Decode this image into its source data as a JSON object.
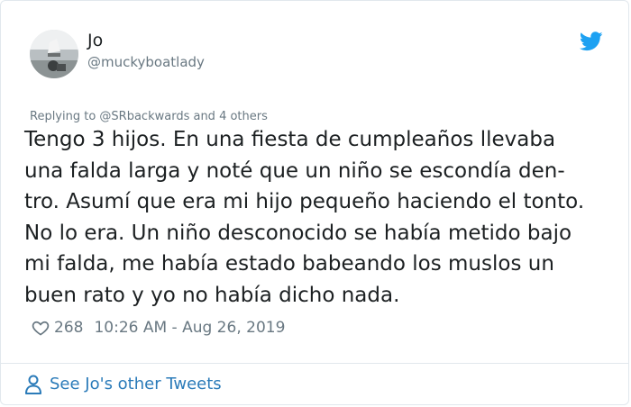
{
  "user": {
    "name": "Jo",
    "handle": "@muckyboatlady"
  },
  "reply": {
    "text": "Replying to @SRbackwards and 4 others"
  },
  "tweet": {
    "text": "Tengo 3 hijos. En una fiesta de cumpleaños llevaba\nuna falda larga y noté que un niño se escondía den-\ntro. Asumí que era mi hijo pequeño haciendo el tonto.\nNo lo era. Un niño desconocido se había metido bajo\nmi falda, me había estado babeando los muslos un\nbuen rato y yo no había dicho nada.",
    "likes": "268",
    "timestamp": "10:26 AM - Aug 26, 2019"
  },
  "footer": {
    "other_tweets_label": "See Jo's other Tweets"
  },
  "colors": {
    "twitter_blue": "#1da1f2",
    "link_blue": "#2b7bb9",
    "muted": "#697882"
  },
  "icons": [
    "avatar",
    "twitter-icon",
    "heart-icon",
    "person-icon"
  ]
}
